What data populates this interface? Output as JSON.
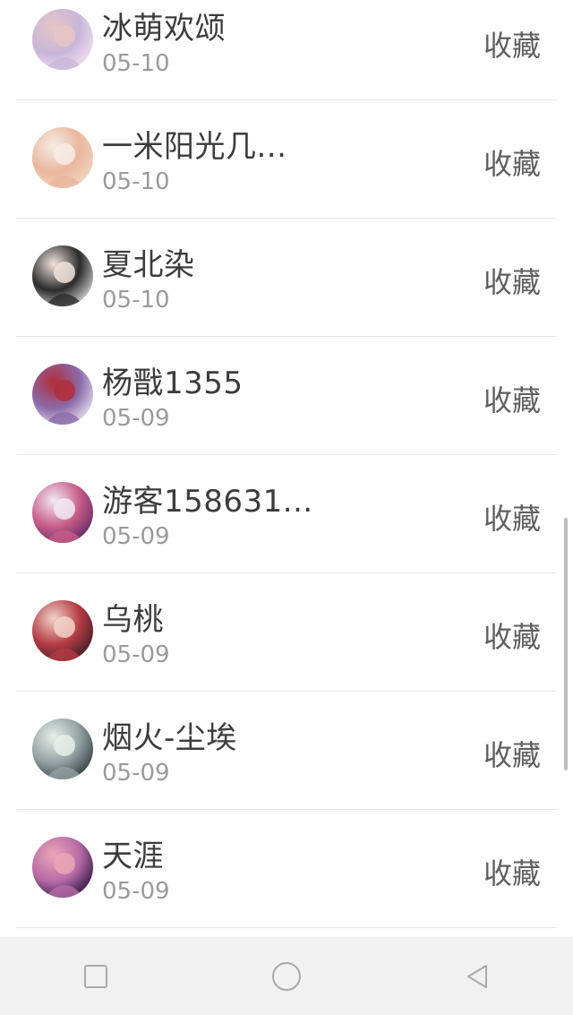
{
  "items": [
    {
      "name": "冰萌欢颂",
      "date": "05-10",
      "action": "收藏",
      "avatar_colors": [
        "#f3e2f2",
        "#c8b6d9",
        "#e7c6c6"
      ]
    },
    {
      "name": "一米阳光几...",
      "date": "05-10",
      "action": "收藏",
      "avatar_colors": [
        "#f4d6c2",
        "#e9b79d",
        "#f7ece6"
      ]
    },
    {
      "name": "夏北染",
      "date": "05-10",
      "action": "收藏",
      "avatar_colors": [
        "#d7d7d7",
        "#2b2b2b",
        "#f0e3dc"
      ]
    },
    {
      "name": "杨戬1355",
      "date": "05-09",
      "action": "收藏",
      "avatar_colors": [
        "#e7e3f1",
        "#8b6aa8",
        "#b22d3a"
      ]
    },
    {
      "name": "游客158631...",
      "date": "05-09",
      "action": "收藏",
      "avatar_colors": [
        "#5f2a63",
        "#c75c88",
        "#f2e9f4"
      ]
    },
    {
      "name": "乌桃",
      "date": "05-09",
      "action": "收藏",
      "avatar_colors": [
        "#3a1d25",
        "#b43b44",
        "#f2d2c9"
      ]
    },
    {
      "name": "烟火-尘埃",
      "date": "05-09",
      "action": "收藏",
      "avatar_colors": [
        "#2f3a3f",
        "#93a0a2",
        "#e7efe9"
      ]
    },
    {
      "name": "天涯",
      "date": "05-09",
      "action": "收藏",
      "avatar_colors": [
        "#2a173e",
        "#b76aa6",
        "#e9a7b7"
      ]
    }
  ],
  "nav": {
    "buttons": [
      "square-icon",
      "circle-icon",
      "back-triangle-icon"
    ],
    "icon_color": "#a9a9a9"
  }
}
